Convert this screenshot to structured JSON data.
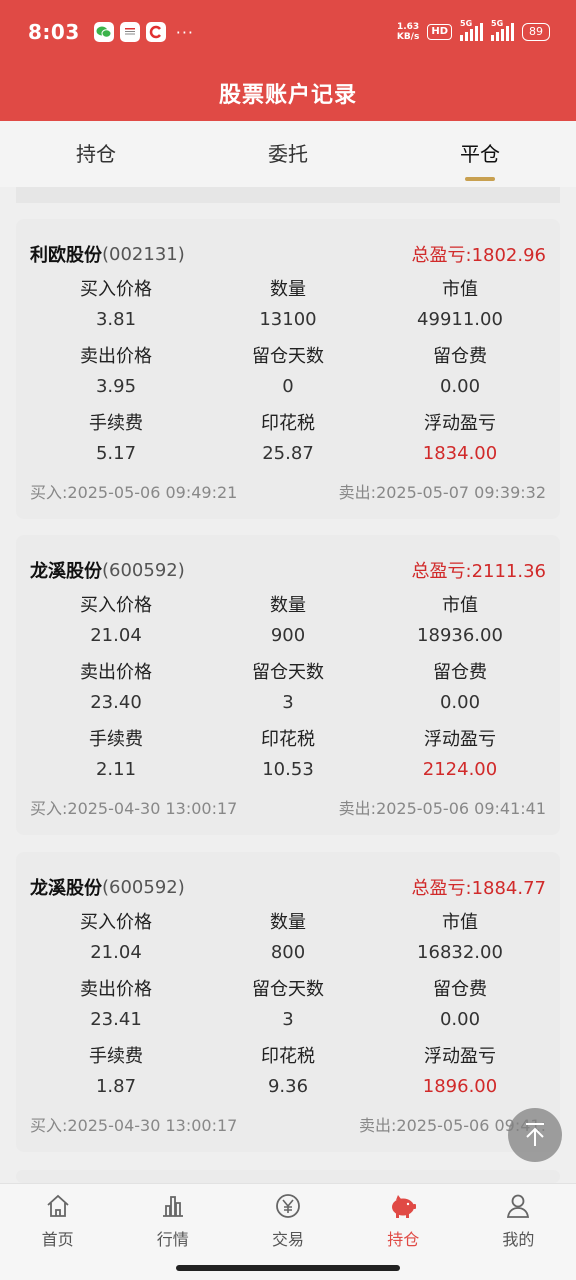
{
  "status": {
    "time": "8:03",
    "speed_top": "1.63",
    "speed_unit": "KB/s",
    "hd": "HD",
    "net1": "5G",
    "net2": "5G",
    "battery": "89"
  },
  "header": {
    "title": "股票账户记录"
  },
  "tabs": [
    {
      "label": "持仓"
    },
    {
      "label": "委托"
    },
    {
      "label": "平仓"
    }
  ],
  "labels": {
    "buy_price": "买入价格",
    "quantity": "数量",
    "market_value": "市值",
    "sell_price": "卖出价格",
    "hold_days": "留仓天数",
    "hold_fee": "留仓费",
    "commission": "手续费",
    "stamp_tax": "印花税",
    "float_pl": "浮动盈亏"
  },
  "cards": [
    {
      "name": "利欧股份",
      "code": "(002131)",
      "total_pl": "总盈亏:1802.96",
      "buy_price": "3.81",
      "quantity": "13100",
      "market_value": "49911.00",
      "sell_price": "3.95",
      "hold_days": "0",
      "hold_fee": "0.00",
      "commission": "5.17",
      "stamp_tax": "25.87",
      "float_pl": "1834.00",
      "buy_time": "买入:2025-05-06 09:49:21",
      "sell_time": "卖出:2025-05-07 09:39:32"
    },
    {
      "name": "龙溪股份",
      "code": "(600592)",
      "total_pl": "总盈亏:2111.36",
      "buy_price": "21.04",
      "quantity": "900",
      "market_value": "18936.00",
      "sell_price": "23.40",
      "hold_days": "3",
      "hold_fee": "0.00",
      "commission": "2.11",
      "stamp_tax": "10.53",
      "float_pl": "2124.00",
      "buy_time": "买入:2025-04-30 13:00:17",
      "sell_time": "卖出:2025-05-06 09:41:41"
    },
    {
      "name": "龙溪股份",
      "code": "(600592)",
      "total_pl": "总盈亏:1884.77",
      "buy_price": "21.04",
      "quantity": "800",
      "market_value": "16832.00",
      "sell_price": "23.41",
      "hold_days": "3",
      "hold_fee": "0.00",
      "commission": "1.87",
      "stamp_tax": "9.36",
      "float_pl": "1896.00",
      "buy_time": "买入:2025-04-30 13:00:17",
      "sell_time": "卖出:2025-05-06 09:41:"
    }
  ],
  "bottom_nav": [
    {
      "label": "首页",
      "icon": "home-icon"
    },
    {
      "label": "行情",
      "icon": "chart-icon"
    },
    {
      "label": "交易",
      "icon": "yen-icon"
    },
    {
      "label": "持仓",
      "icon": "piggy-bank-icon"
    },
    {
      "label": "我的",
      "icon": "user-icon"
    }
  ],
  "colors": {
    "brand_red": "#e04a45",
    "profit_red": "#d12a2a",
    "tab_underline": "#c8a050"
  }
}
